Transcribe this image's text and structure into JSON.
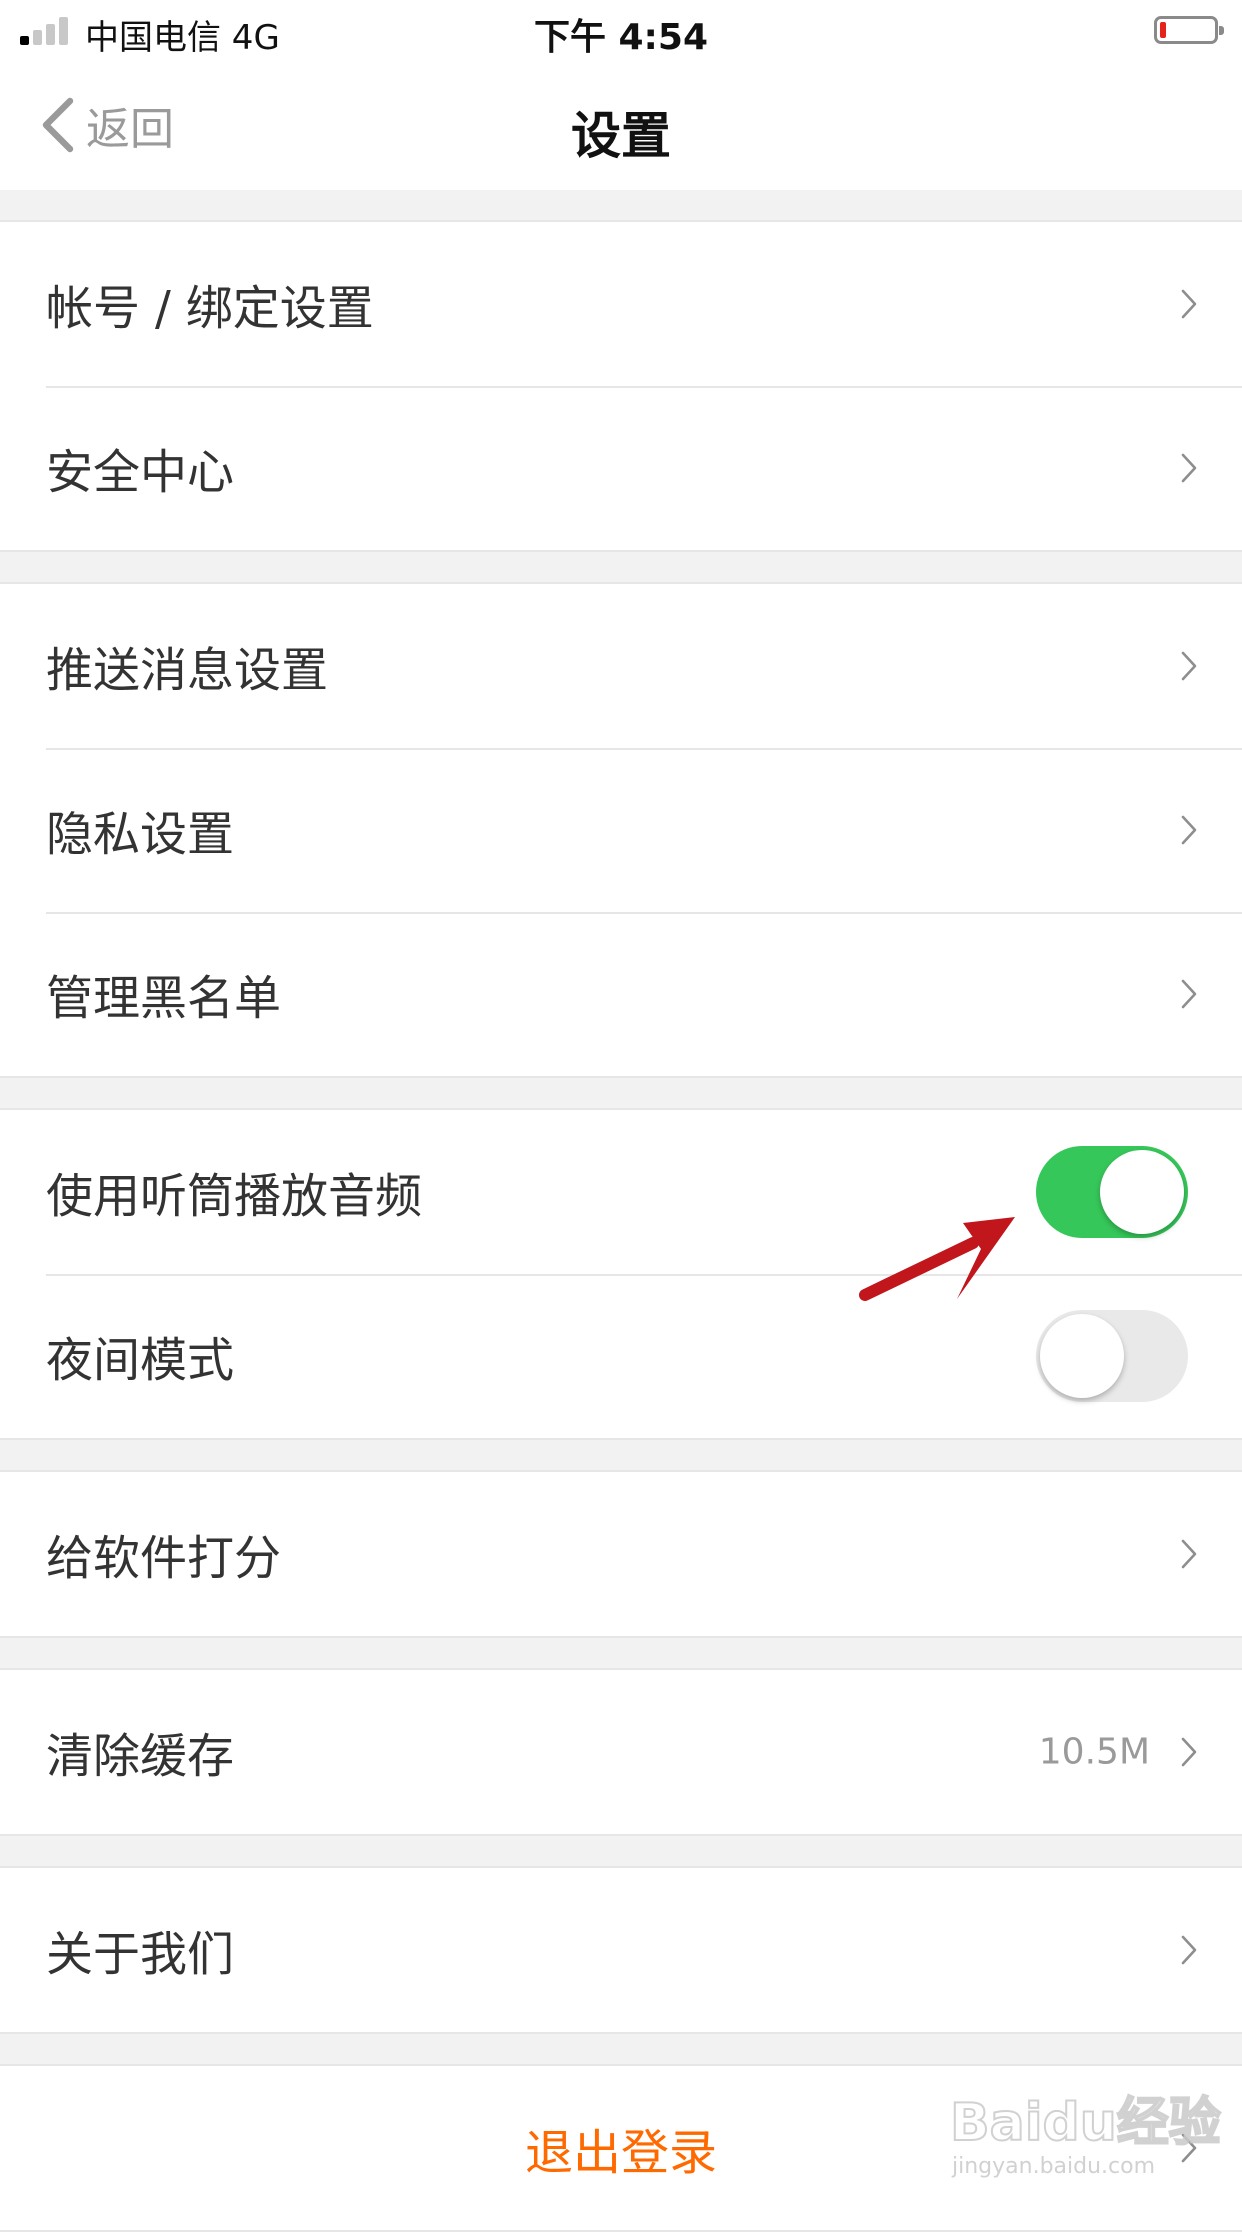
{
  "status_bar": {
    "carrier": "中国电信   4G",
    "time": "下午 4:54",
    "battery_level": 0.12,
    "battery_color": "#e5231a",
    "signal_bars_active": 1
  },
  "nav": {
    "back_label": "返回",
    "title": "设置"
  },
  "sections": {
    "account": {
      "binding": "帐号 / 绑定设置",
      "security": "安全中心"
    },
    "notifications": {
      "push": "推送消息设置",
      "privacy": "隐私设置",
      "blacklist": "管理黑名单"
    },
    "playback": {
      "earpiece": "使用听筒播放音频",
      "earpiece_on": true,
      "night_mode": "夜间模式",
      "night_mode_on": false
    },
    "rate": {
      "label": "给软件打分"
    },
    "cache": {
      "label": "清除缓存",
      "value": "10.5M"
    },
    "about": {
      "label": "关于我们"
    }
  },
  "logout": {
    "label": "退出登录"
  },
  "colors": {
    "accent_orange": "#ff6a00",
    "toggle_green": "#36c75a",
    "arrow_red": "#c0161c"
  },
  "icons": {
    "back": "chevron-left-icon",
    "row": "chevron-right-icon"
  },
  "watermark": {
    "main": "Baidu经验",
    "sub": "jingyan.baidu.com"
  }
}
